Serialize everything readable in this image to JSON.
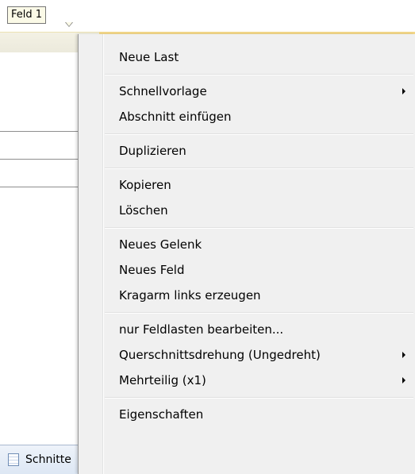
{
  "tooltip": {
    "text": "Feld 1"
  },
  "bottom_tab": {
    "label": "Schnitte",
    "icon": "table-icon"
  },
  "context_menu": {
    "groups": [
      [
        {
          "label": "Neue Last",
          "submenu": false
        }
      ],
      [
        {
          "label": "Schnellvorlage",
          "submenu": true
        },
        {
          "label": "Abschnitt einfügen",
          "submenu": false
        }
      ],
      [
        {
          "label": "Duplizieren",
          "submenu": false
        }
      ],
      [
        {
          "label": "Kopieren",
          "submenu": false
        },
        {
          "label": "Löschen",
          "submenu": false
        }
      ],
      [
        {
          "label": "Neues Gelenk",
          "submenu": false
        },
        {
          "label": "Neues Feld",
          "submenu": false
        },
        {
          "label": "Kragarm links erzeugen",
          "submenu": false
        }
      ],
      [
        {
          "label": "nur Feldlasten bearbeiten...",
          "submenu": false
        },
        {
          "label": "Querschnittsdrehung (Ungedreht)",
          "submenu": true
        },
        {
          "label": "Mehrteilig (x1)",
          "submenu": true
        }
      ],
      [
        {
          "label": "Eigenschaften",
          "submenu": false
        }
      ]
    ]
  },
  "colors": {
    "menu_background": "#f0f0f0",
    "tooltip_background": "#fbfae7",
    "highlight_band": "#f4d88a"
  }
}
